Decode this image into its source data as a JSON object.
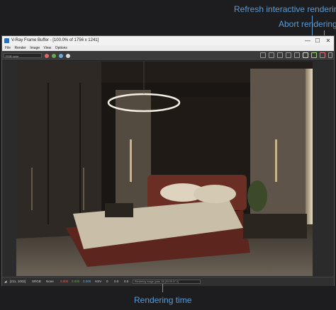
{
  "annotations": {
    "refresh": "Refresh interactive rendering",
    "abort": "Abort rendering",
    "render_time": "Rendering time"
  },
  "window": {
    "title": "V-Ray Frame Buffer - [100.0% of 1756 x 1241]",
    "controls": {
      "minimize": "—",
      "maximize": "☐",
      "close": "✕"
    }
  },
  "menu": [
    "File",
    "Render",
    "Image",
    "View",
    "Options"
  ],
  "toolbar": {
    "channel": "RGB color",
    "channel_dots": [
      "#e06666",
      "#6aa84f",
      "#6fa8dc",
      "#d9d9d9"
    ]
  },
  "status": {
    "coords": "[211, 1002]",
    "srgb": "SRGB",
    "mode": "None",
    "r": "0.000",
    "g": "0.000",
    "b": "0.000",
    "model": "HSV",
    "h": "0",
    "s": "0.0",
    "v": "0.0",
    "render_time": "Rendering image (pass 10) [00:09:37.4]"
  },
  "colors": {
    "accent": "#5b9bd5"
  }
}
